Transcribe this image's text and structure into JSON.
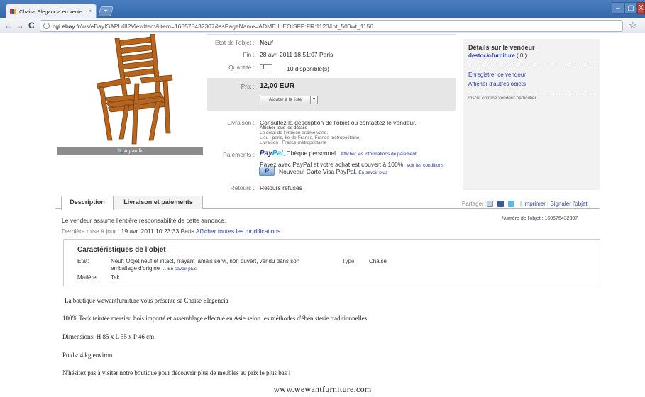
{
  "browser": {
    "tab_title": "Chaise Elegancia en vente ...",
    "tab_close": "×",
    "new_tab": "+",
    "url_host": "cgi.ebay.fr",
    "url_path": "/ws/eBayISAPI.dll?ViewItem&item=160575432307&ssPageName=ADME:L:EOISFP:FR:1123#ht_500wt_1156",
    "back": "←",
    "forward": "→",
    "reload": "C",
    "star": "☆",
    "window_min": "–",
    "window_max": "▢",
    "window_close": "X"
  },
  "image": {
    "enlarge_label": "🔍 Agrandir"
  },
  "item": {
    "state_label": "Etat de l'objet :",
    "state_value": "Neuf",
    "end_label": "Fin :",
    "end_value": "28 avr. 2011 18:51:07 Paris",
    "qty_label": "Quantité :",
    "qty_value": "1",
    "qty_available": "10 disponible(s)",
    "price_label": "Prix :",
    "price_value": "12,00 EUR",
    "watch_button": "Ajouter à la liste",
    "watch_dropdown": "▾",
    "shipping_label": "Livraison :",
    "shipping_text": "Consultez la description de l'objet ou contactez le vendeur.",
    "shipping_sep": "|",
    "shipping_link": "Afficher tous les détails",
    "shipping_line1": "Le délai de livraison estimé varie.",
    "shipping_line2": "Lieu : paris, Ile-de-France, France métropolitaine",
    "shipping_line3": "Livraison : France métropolitaine",
    "payments_label": "Paiements :",
    "paypal_logo_a": "Pay",
    "paypal_logo_b": "Pal",
    "payments_text": ", Chèque personnel |",
    "payments_link": "Afficher les informations de paiement",
    "paypal_cover": "Payez avec PayPal et votre achat est couvert à 100%.",
    "paypal_cover_link": "Voir les conditions",
    "paypal_card_icon": "P",
    "paypal_card": "Nouveau! Carte Visa PayPal.",
    "paypal_card_link": "En savoir plus",
    "returns_label": "Retours :",
    "returns_value": "Retours refusés"
  },
  "seller": {
    "title": "Détails sur le vendeur",
    "name": "destock-furniture",
    "score": "( 0 )",
    "save_seller": "Enregistrer ce vendeur",
    "other_items": "Afficher d'autres objets",
    "registered": "Inscrit comme vendeur particulier"
  },
  "tabs": {
    "description": "Description",
    "shipping": "Livraison et paiements"
  },
  "share": {
    "label": "Partager :",
    "sep": "|",
    "print": "Imprimer",
    "sep2": "|",
    "report": "Signaler l'objet"
  },
  "description": {
    "responsibility": "Le vendeur assume l'entière responsabilité de cette annonce.",
    "item_number": "Numéro de l'objet : 160575432307",
    "last_update_label": "Dernière mise à jour :",
    "last_update_value": "19 avr. 2011 10:23:33 Paris",
    "show_changes": "Afficher toutes les modifications"
  },
  "specs": {
    "title": "Caractéristiques de l'objet",
    "state_label": "Etat:",
    "state_value_1": "Neuf: Objet neuf et intact, n'ayant jamais servi, non ouvert, vendu dans son",
    "state_value_2": "emballage d'origine ...",
    "state_more": "En savoir plus",
    "type_label": "Type:",
    "type_value": "Chaise",
    "material_label": "Matière:",
    "material_value": "Tek"
  },
  "body_text": {
    "p1": "La boutique wewantfurniture vous présente sa Chaise Elegencia",
    "p2": "100% Teck teintée mersier, bois importé et assemblage effectué en Asie selon les méthodes d'ébénisterie traditionnelles",
    "p3": "Dimensions: H 85  x L 55 x P 46 cm",
    "p4": "Poids: 4 kg environ",
    "p5": "N'hésitez pas à visiter notre boutique pour découvrir plus de meubles au prix le plus bas !",
    "footer_url": "www.wewantfurniture.com"
  },
  "colors": {
    "link": "#2a3e9c",
    "paypal_dark": "#253b80",
    "paypal_light": "#179bd7",
    "chair_wood": "#b5651d"
  }
}
